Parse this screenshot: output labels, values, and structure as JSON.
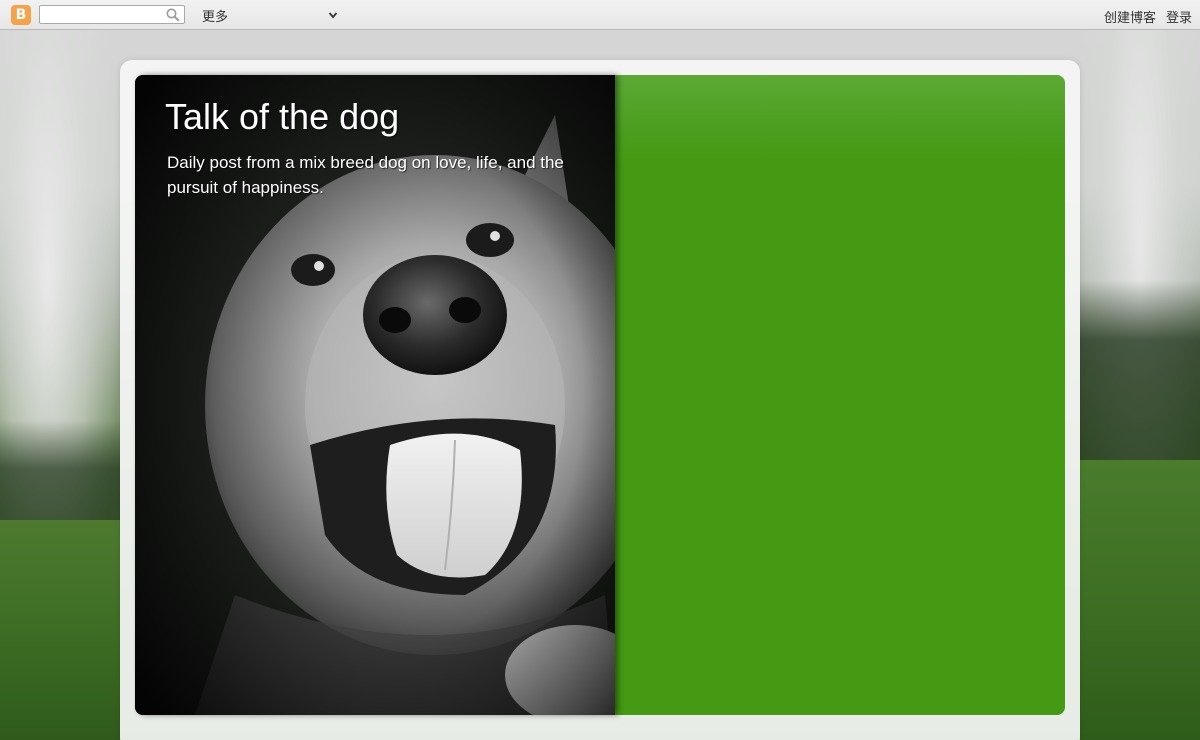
{
  "navbar": {
    "logo_letter": "B",
    "search": {
      "value": "",
      "placeholder": ""
    },
    "more_label": "更多",
    "create_blog_label": "创建博客",
    "sign_in_label": "登录"
  },
  "header": {
    "title": "Talk of the dog",
    "description": "Daily post from a mix breed dog on love, life, and the pursuit of happiness."
  },
  "colors": {
    "header_green": "#449a12",
    "blogger_orange": "#f4a34a"
  },
  "icons": {
    "logo": "blogger-icon",
    "search": "search-icon",
    "dropdown": "chevron-down-icon"
  }
}
